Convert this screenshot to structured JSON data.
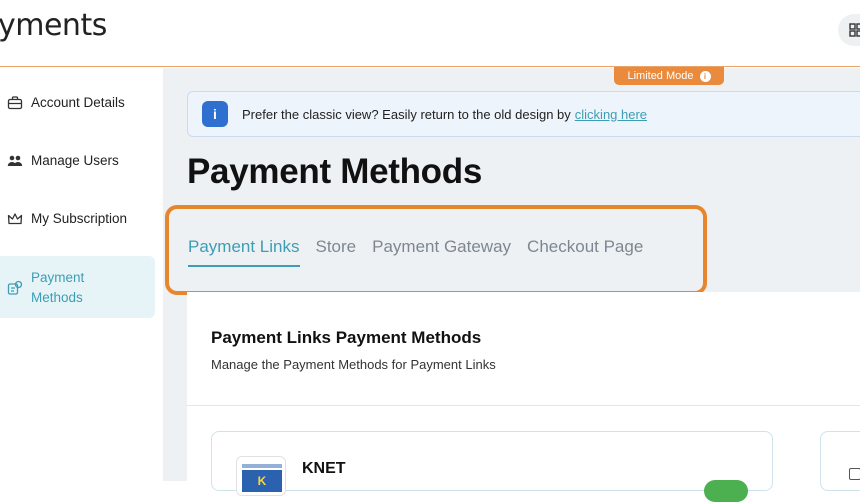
{
  "app": {
    "logo_text": "yments"
  },
  "sidebar": {
    "items": [
      {
        "label": "Account Details",
        "icon": "briefcase-icon"
      },
      {
        "label": "Manage Users",
        "icon": "users-icon"
      },
      {
        "label": "My Subscription",
        "icon": "crown-icon"
      },
      {
        "label": "Payment Methods",
        "icon": "payment-methods-icon",
        "active": true
      }
    ]
  },
  "badge": {
    "label": "Limited Mode",
    "info": "i"
  },
  "banner": {
    "icon": "info-icon",
    "text": "Prefer the classic view? Easily return to the old design by",
    "link": "clicking here"
  },
  "page": {
    "title": "Payment Methods"
  },
  "tabs": [
    {
      "label": "Payment Links",
      "active": true
    },
    {
      "label": "Store"
    },
    {
      "label": "Payment Gateway"
    },
    {
      "label": "Checkout Page"
    }
  ],
  "panel": {
    "title": "Payment Links Payment Methods",
    "subtitle": "Manage the Payment Methods for Payment Links"
  },
  "methods": [
    {
      "name": "KNET",
      "logo_text": "K",
      "enabled": true
    }
  ],
  "colors": {
    "accent": "#3d9db4",
    "highlight": "#e8862e",
    "badge": "#ea8a3c",
    "info": "#2f6fd0",
    "toggle_on": "#4caf50"
  }
}
